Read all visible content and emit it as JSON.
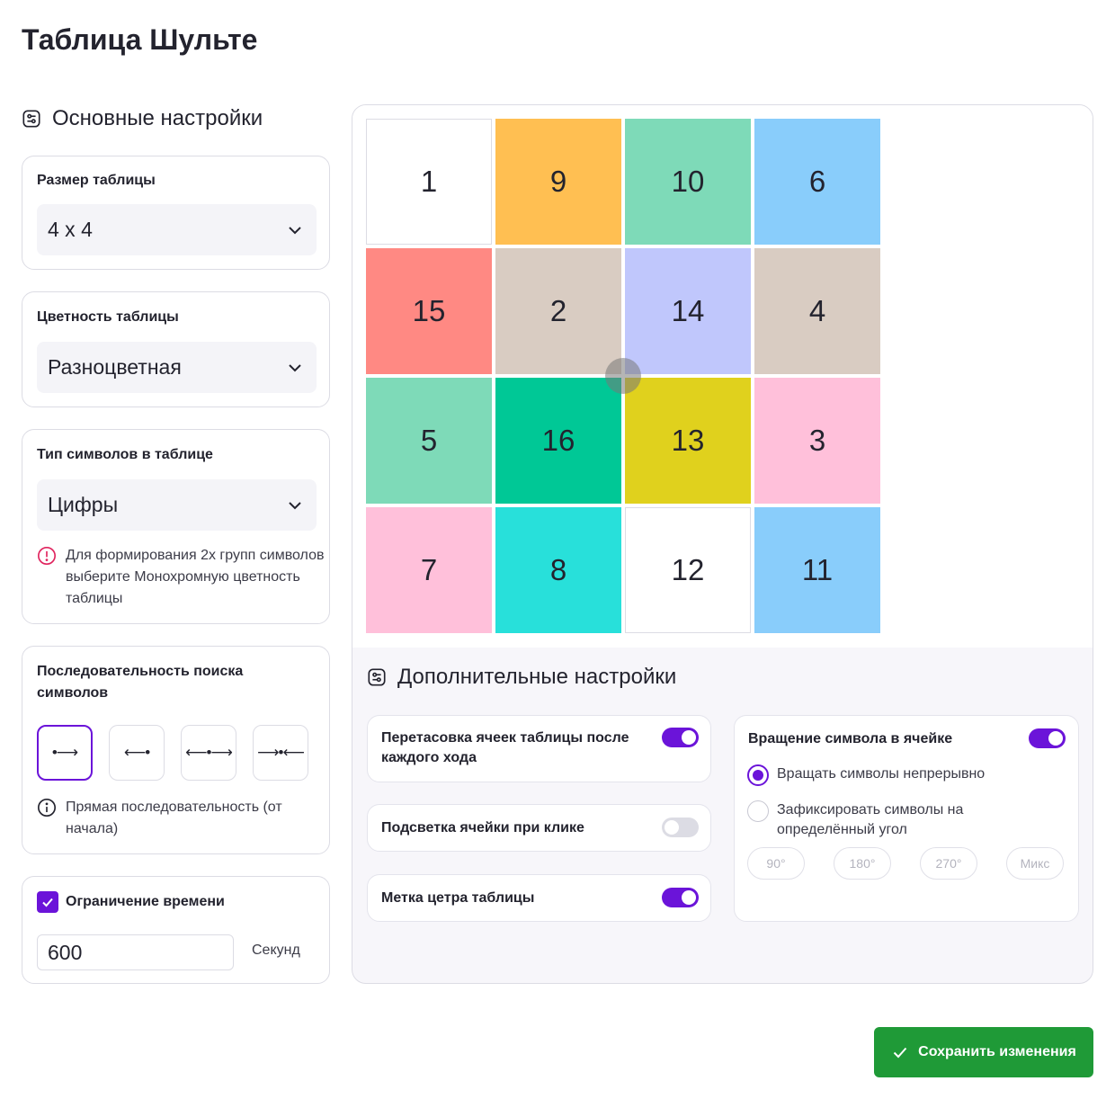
{
  "page": {
    "title": "Таблица Шульте"
  },
  "main_settings": {
    "title": "Основные настройки",
    "table_size": {
      "label": "Размер таблицы",
      "value": "4 x 4"
    },
    "table_color": {
      "label": "Цветность таблицы",
      "value": "Разноцветная"
    },
    "symbol_type": {
      "label": "Тип символов в таблице",
      "value": "Цифры",
      "warning": "Для формирования 2х групп символов выберите Монохромную цветность таблицы"
    },
    "search_order": {
      "label": "Последовательность поиска символов",
      "options": [
        "•⟶",
        "⟵•",
        "⟵•⟶",
        "⟶•⟵"
      ],
      "selected_index": 0,
      "hint": "Прямая последовательность (от начала)"
    },
    "time_limit": {
      "label": "Ограничение времени",
      "checked": true,
      "value": "600",
      "unit": "Секунд"
    }
  },
  "grid": {
    "cells": [
      {
        "value": "1",
        "color": "#ffffff"
      },
      {
        "value": "9",
        "color": "#ffbf52"
      },
      {
        "value": "10",
        "color": "#7edab8"
      },
      {
        "value": "6",
        "color": "#89cdfb"
      },
      {
        "value": "15",
        "color": "#ff8983"
      },
      {
        "value": "2",
        "color": "#d9ccc2"
      },
      {
        "value": "14",
        "color": "#c0c7fc"
      },
      {
        "value": "4",
        "color": "#d9ccc2"
      },
      {
        "value": "5",
        "color": "#7edab8"
      },
      {
        "value": "16",
        "color": "#00c896"
      },
      {
        "value": "13",
        "color": "#e0d11d"
      },
      {
        "value": "3",
        "color": "#ffc0da"
      },
      {
        "value": "7",
        "color": "#ffc0da"
      },
      {
        "value": "8",
        "color": "#28e0da"
      },
      {
        "value": "12",
        "color": "#ffffff"
      },
      {
        "value": "11",
        "color": "#89cdfb"
      }
    ]
  },
  "extra_settings": {
    "title": "Дополнительные настройки",
    "shuffle": {
      "label": "Перетасовка ячеек таблицы после каждого хода",
      "on": true
    },
    "highlight": {
      "label": "Подсветка ячейки при клике",
      "on": false
    },
    "center_mark": {
      "label": "Метка цетра таблицы",
      "on": true
    },
    "rotation": {
      "label": "Вращение символа в ячейке",
      "on": true,
      "options": [
        "Вращать символы непрерывно",
        "Зафиксировать символы на определённый угол"
      ],
      "selected_index": 0,
      "angles": [
        "90°",
        "180°",
        "270°",
        "Микс"
      ]
    }
  },
  "actions": {
    "save_label": "Сохранить изменения"
  },
  "colors": {
    "accent": "#6b14d9",
    "save": "#1f9a37",
    "warning": "#e0245e"
  }
}
